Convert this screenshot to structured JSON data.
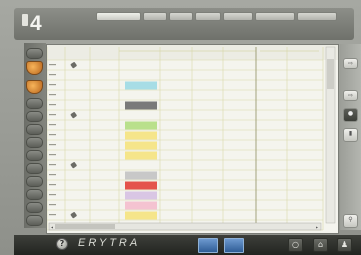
{
  "app": {
    "logo_number": "4",
    "brand": "ERYTRA"
  },
  "top_tabs": [
    "",
    "",
    "",
    "",
    "",
    "",
    ""
  ],
  "table": {
    "group_headers": [
      "",
      ""
    ],
    "column_headers": [
      "",
      "",
      "",
      "",
      "",
      "",
      "",
      ""
    ],
    "row_count": 17,
    "colors": {
      "light_blue": "#a7dde6",
      "dark_gray": "#7a7a7a",
      "light_green": "#b9e08c",
      "yellow": "#f5e58a",
      "light_gray": "#c8c8c8",
      "red": "#e4534c",
      "lavender": "#d9c6e4",
      "pink": "#f4c3d1",
      "grid_line": "#d8d8a8"
    },
    "swatches": [
      {
        "row": 3,
        "color": "light_blue"
      },
      {
        "row": 5,
        "color": "dark_gray"
      },
      {
        "row": 7,
        "color": "light_green"
      },
      {
        "row": 8,
        "color": "yellow"
      },
      {
        "row": 9,
        "color": "yellow"
      },
      {
        "row": 10,
        "color": "yellow"
      },
      {
        "row": 12,
        "color": "light_gray"
      },
      {
        "row": 13,
        "color": "red"
      },
      {
        "row": 14,
        "color": "lavender"
      },
      {
        "row": 15,
        "color": "pink"
      },
      {
        "row": 16,
        "color": "yellow"
      }
    ]
  },
  "icons": {
    "left_rail": [
      "tool-icon",
      "orange-tube-icon",
      "orange-tube-icon",
      "rack-icon",
      "rack-icon",
      "rack-icon",
      "rack-icon",
      "rack-icon",
      "rack-icon",
      "rack-icon",
      "rack-icon",
      "rack-icon",
      "rack-icon",
      "rack-icon"
    ],
    "right_rail": [
      "arrow-icon",
      "arrow-icon",
      "lock-icon",
      "tube-icon",
      "search-icon"
    ],
    "bottom": [
      "help-icon",
      "window-icon",
      "window-icon",
      "circle-icon",
      "home-icon",
      "user-icon"
    ]
  }
}
